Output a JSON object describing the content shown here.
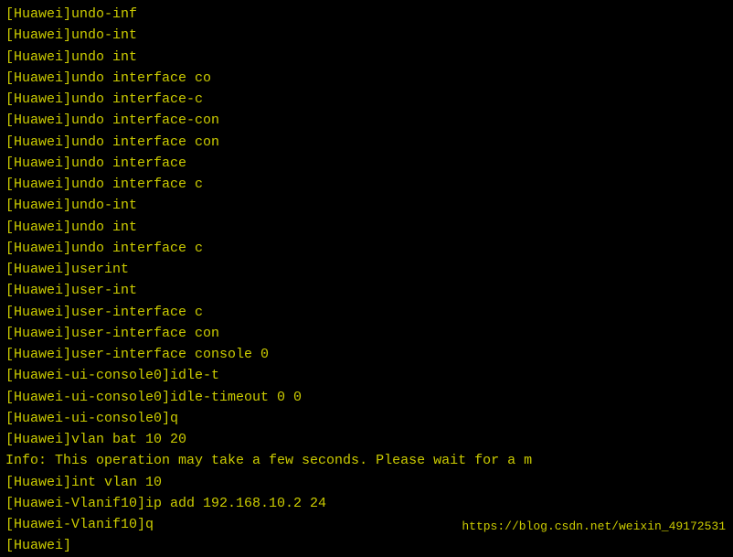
{
  "terminal": {
    "lines": [
      "[Huawei]undo-inf",
      "[Huawei]undo-int",
      "[Huawei]undo int",
      "[Huawei]undo interface co",
      "[Huawei]undo interface-c",
      "[Huawei]undo interface-con",
      "[Huawei]undo interface con",
      "[Huawei]undo interface",
      "[Huawei]undo interface c",
      "[Huawei]undo-int",
      "[Huawei]undo int",
      "[Huawei]undo interface c",
      "[Huawei]userint",
      "[Huawei]user-int",
      "[Huawei]user-interface c",
      "[Huawei]user-interface con",
      "[Huawei]user-interface console 0",
      "[Huawei-ui-console0]idle-t",
      "[Huawei-ui-console0]idle-timeout 0 0",
      "[Huawei-ui-console0]q",
      "[Huawei]vlan bat 10 20",
      "Info: This operation may take a few seconds. Please wait for a m",
      "[Huawei]int vlan 10",
      "[Huawei-Vlanif10]ip add 192.168.10.2 24",
      "[Huawei-Vlanif10]q",
      "[Huawei]"
    ],
    "watermark": "https://blog.csdn.net/weixin_49172531"
  }
}
